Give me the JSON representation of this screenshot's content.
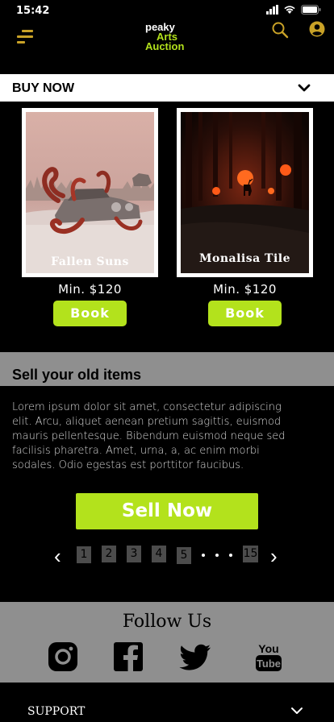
{
  "status": {
    "time": "15:42"
  },
  "header": {
    "logo_line1": "peaky",
    "logo_line2": "Arts",
    "logo_line3": "Auction",
    "icons": [
      "menu-icon",
      "search-icon",
      "profile-icon"
    ]
  },
  "buy": {
    "title": "BUY NOW"
  },
  "cards": [
    {
      "title": "Fallen Suns",
      "price": "Min. $120",
      "button": "Book"
    },
    {
      "title": "Monalisa Tile",
      "price": "Min. $120",
      "button": "Book"
    }
  ],
  "sell": {
    "title": "Sell your old items",
    "text": "Lorem ipsum dolor sit amet, consectetur adipiscing elit. Arcu, aliquet aenean pretium sagittis, euismod mauris pellentesque. Bibendum euismod neque sed facilisis pharetra. Amet, urna, a, ac enim morbi sodales. Odio egestas est porttitor faucibus.",
    "button": "Sell Now"
  },
  "pagination": {
    "prev": "‹",
    "next": "›",
    "pages": [
      "1",
      "2",
      "3",
      "4",
      "5"
    ],
    "last": "15"
  },
  "follow": {
    "title": "Follow Us",
    "networks": [
      "instagram-icon",
      "facebook-icon",
      "twitter-icon",
      "youtube-icon"
    ]
  },
  "support": {
    "label": "SUPPORT"
  },
  "colors": {
    "accent": "#b3e21c",
    "menu": "#c9a227",
    "band": "#8f8f8f"
  }
}
